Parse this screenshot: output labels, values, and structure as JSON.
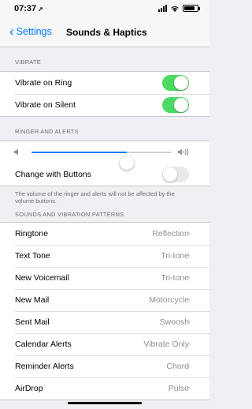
{
  "status_bar": {
    "time": "07:37",
    "location_glyph": "➚"
  },
  "nav": {
    "back_label": "Settings",
    "title": "Sounds & Haptics"
  },
  "vibrate": {
    "header": "VIBRATE",
    "rows": [
      {
        "label": "Vibrate on Ring",
        "on": true
      },
      {
        "label": "Vibrate on Silent",
        "on": true
      }
    ]
  },
  "ringer": {
    "header": "RINGER AND ALERTS",
    "volume_level": 0.68,
    "change_with_buttons_label": "Change with Buttons",
    "change_with_buttons_on": false,
    "note": "The volume of the ringer and alerts will not be affected by the volume buttons."
  },
  "patterns": {
    "header": "SOUNDS AND VIBRATION PATTERNS",
    "rows": [
      {
        "label": "Ringtone",
        "value": "Reflection"
      },
      {
        "label": "Text Tone",
        "value": "Tri-tone"
      },
      {
        "label": "New Voicemail",
        "value": "Tri-tone"
      },
      {
        "label": "New Mail",
        "value": "Motorcycle"
      },
      {
        "label": "Sent Mail",
        "value": "Swoosh"
      },
      {
        "label": "Calendar Alerts",
        "value": "Vibrate Only"
      },
      {
        "label": "Reminder Alerts",
        "value": "Chord"
      },
      {
        "label": "AirDrop",
        "value": "Pulse"
      }
    ]
  },
  "colors": {
    "accent": "#007aff",
    "toggle_on": "#4cd964",
    "background": "#efeff4"
  }
}
